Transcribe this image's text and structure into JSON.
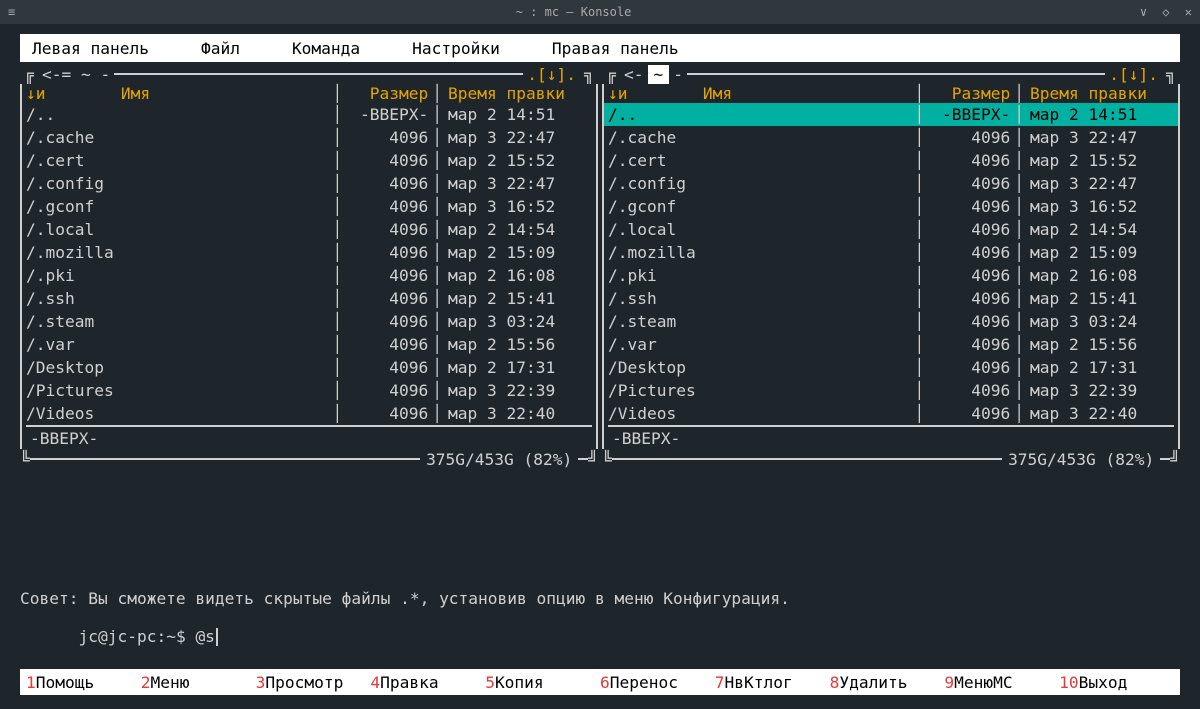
{
  "window": {
    "title": "~ : mc — Konsole",
    "appmenu_icon": "≡"
  },
  "menubar": {
    "items": [
      "Левая панель",
      "Файл",
      "Команда",
      "Настройки",
      "Правая панель"
    ]
  },
  "columns": {
    "name": "Имя",
    "size": "Размер",
    "mtime": "Время правки",
    "sort_indicator": ".и",
    "panel_indicator": ".[↓]."
  },
  "panel_left": {
    "path": "~",
    "focus": false,
    "top_left": "<-= ~ -",
    "rows": [
      {
        "name": "/..",
        "size": "-ВВЕРХ-",
        "mtime": "мар  2 14:51",
        "sel": false
      },
      {
        "name": "/.cache",
        "size": "4096",
        "mtime": "мар  3 22:47",
        "sel": false
      },
      {
        "name": "/.cert",
        "size": "4096",
        "mtime": "мар  2 15:52",
        "sel": false
      },
      {
        "name": "/.config",
        "size": "4096",
        "mtime": "мар  3 22:47",
        "sel": false
      },
      {
        "name": "/.gconf",
        "size": "4096",
        "mtime": "мар  3 16:52",
        "sel": false
      },
      {
        "name": "/.local",
        "size": "4096",
        "mtime": "мар  2 14:54",
        "sel": false
      },
      {
        "name": "/.mozilla",
        "size": "4096",
        "mtime": "мар  2 15:09",
        "sel": false
      },
      {
        "name": "/.pki",
        "size": "4096",
        "mtime": "мар  2 16:08",
        "sel": false
      },
      {
        "name": "/.ssh",
        "size": "4096",
        "mtime": "мар  2 15:41",
        "sel": false
      },
      {
        "name": "/.steam",
        "size": "4096",
        "mtime": "мар  3 03:24",
        "sel": false
      },
      {
        "name": "/.var",
        "size": "4096",
        "mtime": "мар  2 15:56",
        "sel": false
      },
      {
        "name": "/Desktop",
        "size": "4096",
        "mtime": "мар  2 17:31",
        "sel": false
      },
      {
        "name": "/Pictures",
        "size": "4096",
        "mtime": "мар  3 22:39",
        "sel": false
      },
      {
        "name": "/Videos",
        "size": "4096",
        "mtime": "мар  3 22:40",
        "sel": false
      }
    ],
    "footer": "-ВВЕРХ-",
    "disk": "375G/453G (82%)"
  },
  "panel_right": {
    "path": "~",
    "focus": true,
    "rows": [
      {
        "name": "/..",
        "size": "-ВВЕРХ-",
        "mtime": "мар  2 14:51",
        "sel": true
      },
      {
        "name": "/.cache",
        "size": "4096",
        "mtime": "мар  3 22:47",
        "sel": false
      },
      {
        "name": "/.cert",
        "size": "4096",
        "mtime": "мар  2 15:52",
        "sel": false
      },
      {
        "name": "/.config",
        "size": "4096",
        "mtime": "мар  3 22:47",
        "sel": false
      },
      {
        "name": "/.gconf",
        "size": "4096",
        "mtime": "мар  3 16:52",
        "sel": false
      },
      {
        "name": "/.local",
        "size": "4096",
        "mtime": "мар  2 14:54",
        "sel": false
      },
      {
        "name": "/.mozilla",
        "size": "4096",
        "mtime": "мар  2 15:09",
        "sel": false
      },
      {
        "name": "/.pki",
        "size": "4096",
        "mtime": "мар  2 16:08",
        "sel": false
      },
      {
        "name": "/.ssh",
        "size": "4096",
        "mtime": "мар  2 15:41",
        "sel": false
      },
      {
        "name": "/.steam",
        "size": "4096",
        "mtime": "мар  3 03:24",
        "sel": false
      },
      {
        "name": "/.var",
        "size": "4096",
        "mtime": "мар  2 15:56",
        "sel": false
      },
      {
        "name": "/Desktop",
        "size": "4096",
        "mtime": "мар  2 17:31",
        "sel": false
      },
      {
        "name": "/Pictures",
        "size": "4096",
        "mtime": "мар  3 22:39",
        "sel": false
      },
      {
        "name": "/Videos",
        "size": "4096",
        "mtime": "мар  3 22:40",
        "sel": false
      }
    ],
    "footer": "-ВВЕРХ-",
    "disk": "375G/453G (82%)"
  },
  "hint": "Совет: Вы сможете видеть скрытые файлы .*, установив опцию в меню Конфигурация.",
  "prompt": {
    "ps1": "jc@jc-pc:~$ ",
    "input": "@s"
  },
  "fkeys": [
    {
      "n": "1",
      "l": "Помощь"
    },
    {
      "n": "2",
      "l": "Меню"
    },
    {
      "n": "3",
      "l": "Просмотр"
    },
    {
      "n": "4",
      "l": "Правка"
    },
    {
      "n": "5",
      "l": "Копия"
    },
    {
      "n": "6",
      "l": "Перенос"
    },
    {
      "n": "7",
      "l": "НвКтлог"
    },
    {
      "n": "8",
      "l": "Удалить"
    },
    {
      "n": "9",
      "l": "МенюМС"
    },
    {
      "n": "10",
      "l": "Выход"
    }
  ]
}
